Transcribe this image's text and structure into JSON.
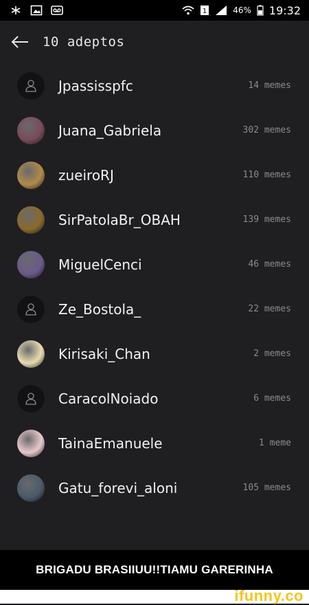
{
  "status_bar": {
    "battery_percent": "46%",
    "time": "19:32",
    "icons": [
      "asterisk-icon",
      "image-icon",
      "voicemail-icon",
      "wifi-icon",
      "sim-icon",
      "signal-icon",
      "battery-icon"
    ]
  },
  "app_bar": {
    "title": "10 adeptos",
    "back_icon": "arrow-left-icon"
  },
  "followers": [
    {
      "username": "Jpassisspfc",
      "memes": "14 memes",
      "avatar": "placeholder",
      "color": "#121215"
    },
    {
      "username": "Juana_Gabriela",
      "memes": "302 memes",
      "avatar": "photo",
      "color": "#7a4a5a"
    },
    {
      "username": "zueiroRJ",
      "memes": "110 memes",
      "avatar": "photo",
      "color": "#b08a4a"
    },
    {
      "username": "SirPatolaBr_OBAH",
      "memes": "139 memes",
      "avatar": "photo",
      "color": "#8a6a2a"
    },
    {
      "username": "MiguelCenci",
      "memes": "46 memes",
      "avatar": "photo",
      "color": "#6a5a8a"
    },
    {
      "username": "Ze_Bostola_",
      "memes": "22 memes",
      "avatar": "placeholder",
      "color": "#121215"
    },
    {
      "username": "Kirisaki_Chan",
      "memes": "2 memes",
      "avatar": "photo",
      "color": "#e8dcb0"
    },
    {
      "username": "CaracolNoiado",
      "memes": "6 memes",
      "avatar": "placeholder",
      "color": "#121215"
    },
    {
      "username": "TainaEmanuele",
      "memes": "1 meme",
      "avatar": "photo",
      "color": "#e8c8cc"
    },
    {
      "username": "Gatu_forevi_aloni",
      "memes": "105 memes",
      "avatar": "photo",
      "color": "#4a5a6a"
    }
  ],
  "caption": "BRIGADU BRASIIUU!!TIAMU GARERINHA",
  "watermark": "ifunny.co"
}
